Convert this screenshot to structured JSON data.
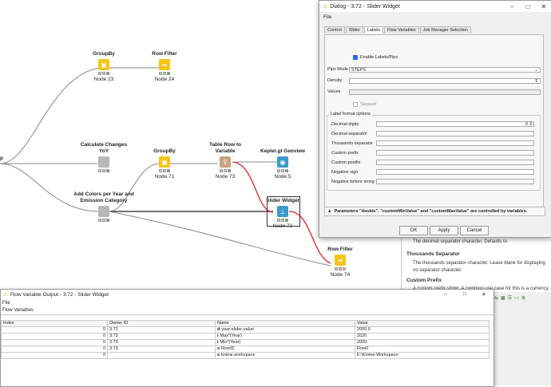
{
  "canvas": {
    "left_fragment": "p",
    "nodes": [
      {
        "id": "node-23",
        "title": "GroupBy",
        "label": "Node 23",
        "color": "yellow",
        "glyph": "▣"
      },
      {
        "id": "node-24",
        "title": "Row Filter",
        "label": "Node 24",
        "color": "yellow",
        "glyph": "⇛"
      },
      {
        "id": "node-yoy",
        "title": "Calculate Changes YoY",
        "label": "",
        "color": "gray",
        "glyph": ""
      },
      {
        "id": "node-71",
        "title": "GroupBy",
        "label": "Node 71",
        "color": "yellow",
        "glyph": "▣"
      },
      {
        "id": "node-73",
        "title": "Table Row to Variable",
        "label": "Node 73",
        "color": "tan",
        "glyph": "⊽"
      },
      {
        "id": "node-5",
        "title": "Kepler.gl Geoview",
        "label": "Node 5",
        "color": "teal",
        "glyph": "◉"
      },
      {
        "id": "node-colors",
        "title": "Add Colors per Year and Emission Category",
        "label": "",
        "color": "gray",
        "glyph": ""
      },
      {
        "id": "node-72",
        "title": "Slider Widget",
        "label": "Node 72",
        "color": "teal",
        "glyph": "⊥"
      },
      {
        "id": "node-74",
        "title": "Row Filter",
        "label": "Node 74",
        "color": "yellow",
        "glyph": "⇛"
      }
    ]
  },
  "dialog": {
    "title": "Dialog - 3:72 - Slider Widget",
    "menu": "File",
    "tabs": [
      "Control",
      "Slider",
      "Labels",
      "Flow Variables",
      "Job Manager Selection"
    ],
    "active_tab": "Labels",
    "enable_labels": "Enable Labels/Pips",
    "pips_mode_label": "Pips Mode",
    "pips_mode_value": "STEPS",
    "density_label": "Density",
    "values_label": "Values",
    "stepped_label": "Stepped",
    "format_group": "Label format options",
    "fields": [
      {
        "label": "Decimal digits",
        "value": "0"
      },
      {
        "label": "Decimal separator",
        "value": "."
      },
      {
        "label": "Thousands separator",
        "value": ""
      },
      {
        "label": "Custom prefix",
        "value": ""
      },
      {
        "label": "Custom postfix",
        "value": ""
      },
      {
        "label": "Negative sign",
        "value": "-"
      },
      {
        "label": "Negative before string",
        "value": ""
      }
    ],
    "warning": "Parameters \"double\", \"customMinValue\" and \"customMaxValue\" are controlled by variables.",
    "buttons": {
      "ok": "OK",
      "apply": "Apply",
      "cancel": "Cancel"
    }
  },
  "description": {
    "line1": "The decimal separator character. Defaults to",
    "h1": "Thousands Separator",
    "p1a": "The thousands separator character. Leave blank for displaying",
    "p1b": "no separator character.",
    "h2": "Custom Prefix",
    "p2": "A custom prefix string. A common use case for this is a currency"
  },
  "fvo": {
    "title": "Flow Variable Output - 3:72 - Slider Widget",
    "menu": "File",
    "tab": "Flow Variables",
    "headers": [
      "Index",
      "Owner ID",
      "Name",
      "Value"
    ],
    "rows": [
      {
        "index": "0",
        "owner": "3:72",
        "type": "d",
        "name": "year-slider-value",
        "value": "2000.0"
      },
      {
        "index": "0",
        "owner": "3:73",
        "type": "i",
        "name": "Max*(Year)",
        "value": "2020"
      },
      {
        "index": "0",
        "owner": "3:73",
        "type": "i",
        "name": "Min*(Year)",
        "value": "2000"
      },
      {
        "index": "0",
        "owner": "3:73",
        "type": "s",
        "name": "RowID",
        "value": "Row0"
      },
      {
        "index": "0",
        "owner": "",
        "type": "s",
        "name": "knime.workspace",
        "value": "E:\\Knime-Workspace"
      }
    ]
  }
}
